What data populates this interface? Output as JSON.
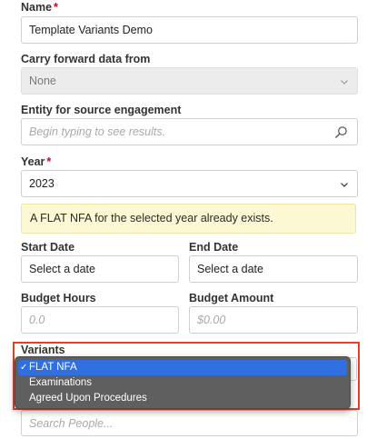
{
  "name": {
    "label": "Name",
    "required_mark": "*",
    "value": "Template Variants Demo"
  },
  "carry_forward": {
    "label": "Carry forward data from",
    "value": "None"
  },
  "entity": {
    "label": "Entity for source engagement",
    "placeholder": "Begin typing to see results."
  },
  "year": {
    "label": "Year",
    "required_mark": "*",
    "value": "2023"
  },
  "notice": {
    "text": "A FLAT NFA for the selected year already exists."
  },
  "start_date": {
    "label": "Start Date",
    "value": "Select a date"
  },
  "end_date": {
    "label": "End Date",
    "value": "Select a date"
  },
  "budget_hours": {
    "label": "Budget Hours",
    "placeholder": "0.0"
  },
  "budget_amount": {
    "label": "Budget Amount",
    "placeholder": "$0.00"
  },
  "variants": {
    "label": "Variants",
    "check_mark": "✓",
    "options": [
      {
        "label": "FLAT NFA",
        "selected": true
      },
      {
        "label": "Examinations",
        "selected": false
      },
      {
        "label": "Agreed Upon Procedures",
        "selected": false
      }
    ]
  },
  "people": {
    "placeholder": "Search People..."
  },
  "colors": {
    "required": "#d0021b",
    "notice_bg": "#fdf8d4",
    "highlight_border": "#e0402e",
    "dropdown_bg": "#5f5f5f",
    "dropdown_selected": "#2f6fe0"
  },
  "icons": {
    "chevron": "chevron-down-icon",
    "search": "search-icon",
    "check": "checkmark-icon"
  }
}
